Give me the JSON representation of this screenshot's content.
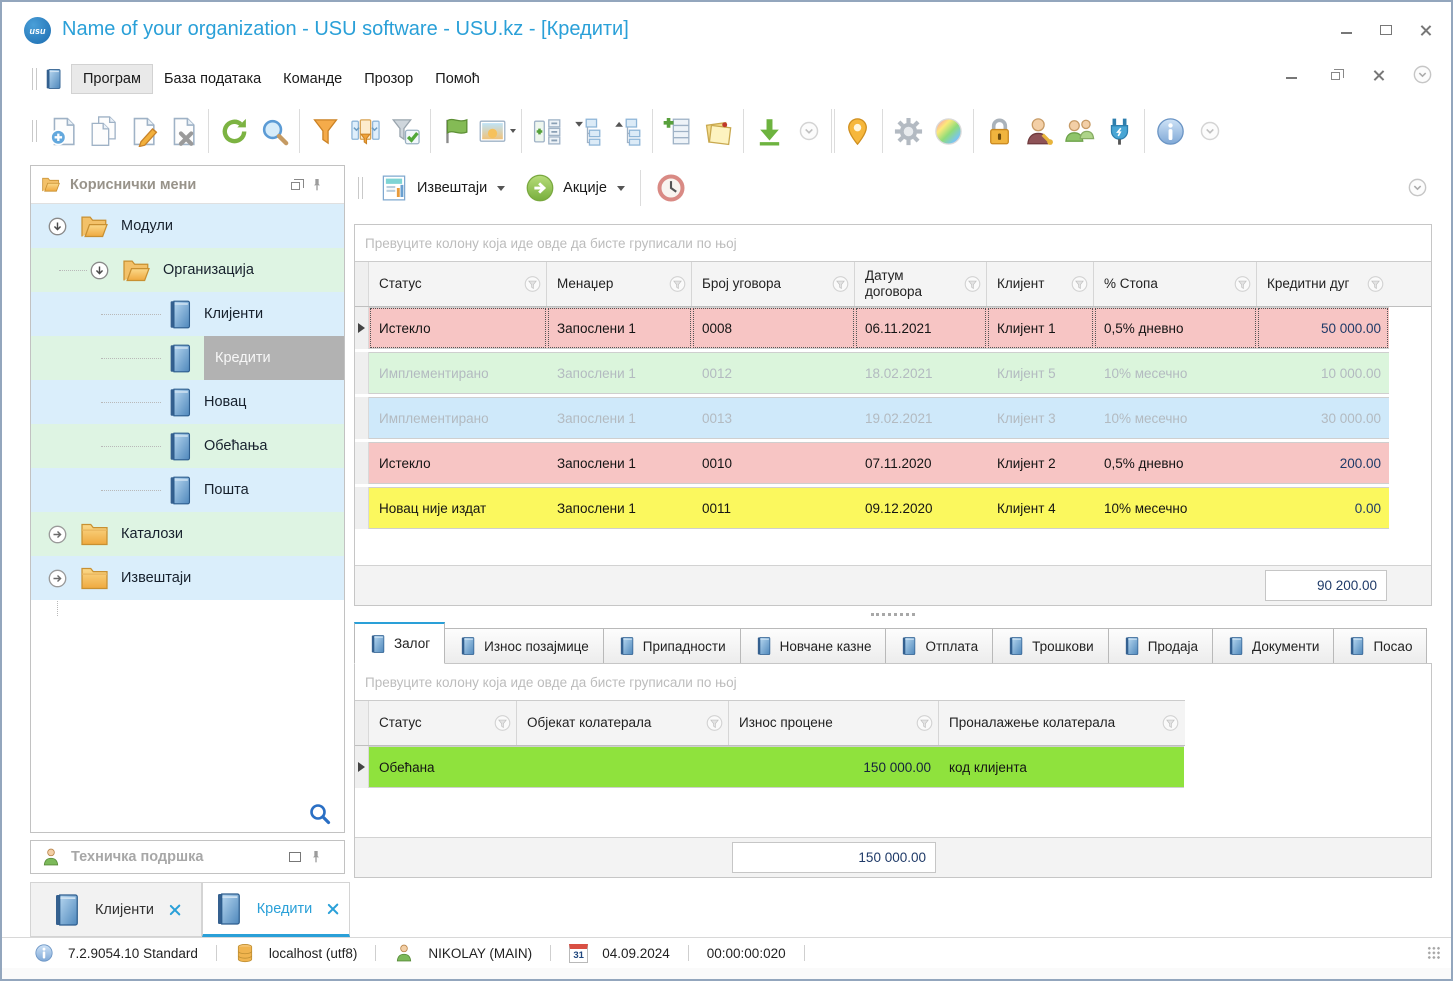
{
  "window": {
    "title": "Name of your organization - USU software - USU.kz - [Кредити]",
    "logo_text": "usu"
  },
  "menu": {
    "items": [
      {
        "label": "Програм"
      },
      {
        "label": "База података"
      },
      {
        "label": "Команде"
      },
      {
        "label": "Прозор"
      },
      {
        "label": "Помоћ"
      }
    ]
  },
  "toolbar": {
    "icons": [
      "new-document",
      "copy-document",
      "edit-document",
      "delete-document",
      "refresh",
      "search",
      "filter",
      "filter-columns",
      "filter-apply",
      "flag",
      "image",
      "tree-list",
      "expand-tree",
      "collapse-tree",
      "add-column",
      "notes",
      "export-download",
      "more-chevron",
      "location-pin",
      "settings-gear",
      "color-palette",
      "lock",
      "user-permissions",
      "user-groups",
      "plugin",
      "info",
      "more-chevron"
    ]
  },
  "sidebar": {
    "title": "Кориснички мени",
    "tree": [
      {
        "label": "Модули"
      },
      {
        "label": "Организација"
      },
      {
        "label": "Клијенти"
      },
      {
        "label": "Кредити"
      },
      {
        "label": "Новац"
      },
      {
        "label": "Обећања"
      },
      {
        "label": "Пошта"
      },
      {
        "label": "Каталози"
      },
      {
        "label": "Извештаји"
      }
    ],
    "support_label": "Техничка подршка"
  },
  "command_bar": {
    "reports": "Извештаји",
    "actions": "Акције"
  },
  "grid": {
    "group_hint": "Превуците колону која иде овде да бисте груписали по њој",
    "columns": [
      "Статус",
      "Менаџер",
      "Број уговора",
      "Датум договора",
      "Клијент",
      "% Стопа",
      "Кредитни дуг"
    ],
    "rows": [
      {
        "status": "Истекло",
        "manager": "Запослени 1",
        "contract": "0008",
        "date": "06.11.2021",
        "client": "Клијент 1",
        "rate": "0,5% дневно",
        "debt": "50 000.00"
      },
      {
        "status": "Имплементирано",
        "manager": "Запослени 1",
        "contract": "0012",
        "date": "18.02.2021",
        "client": "Клијент 5",
        "rate": "10% месечно",
        "debt": "10 000.00"
      },
      {
        "status": "Имплементирано",
        "manager": "Запослени 1",
        "contract": "0013",
        "date": "19.02.2021",
        "client": "Клијент 3",
        "rate": "10% месечно",
        "debt": "30 000.00"
      },
      {
        "status": "Истекло",
        "manager": "Запослени 1",
        "contract": "0010",
        "date": "07.11.2020",
        "client": "Клијент 2",
        "rate": "0,5% дневно",
        "debt": "200.00"
      },
      {
        "status": "Новац није издат",
        "manager": "Запослени 1",
        "contract": "0011",
        "date": "09.12.2020",
        "client": "Клијент 4",
        "rate": "10% месечно",
        "debt": "0.00"
      }
    ],
    "total": "90 200.00",
    "row_colors": {
      "expired": "#f7c5c4",
      "implemented_green": "#dbf5dc",
      "implemented_blue": "#cfe9fa",
      "money_not_issued": "#fbf85e"
    }
  },
  "detail_tabs": [
    {
      "label": "Залог"
    },
    {
      "label": "Износ позајмице"
    },
    {
      "label": "Припадности"
    },
    {
      "label": "Новчане казне"
    },
    {
      "label": "Отплата"
    },
    {
      "label": "Трошкови"
    },
    {
      "label": "Продаја"
    },
    {
      "label": "Документи"
    },
    {
      "label": "Посао"
    }
  ],
  "detail_grid": {
    "group_hint": "Превуците колону која иде овде да бисте груписали по њој",
    "columns": [
      "Статус",
      "Објекат колатерала",
      "Износ процене",
      "Проналажење колатерала"
    ],
    "rows": [
      {
        "status": "Обећана",
        "object": "",
        "amount": "150 000.00",
        "location": "код клијента"
      }
    ],
    "total": "150 000.00",
    "row_color": "#8fe23d"
  },
  "doc_tabs": [
    {
      "label": "Клијенти"
    },
    {
      "label": "Кредити"
    }
  ],
  "statusbar": {
    "version": "7.2.9054.10 Standard",
    "database": "localhost (utf8)",
    "user": "NIKOLAY (MAIN)",
    "calendar_day": "31",
    "date": "04.09.2024",
    "timer": "00:00:00:020"
  },
  "colors": {
    "accent_blue": "#2aa0d8",
    "tree_row_blue": "#daeefb",
    "tree_row_green": "#def4e3",
    "selected_tree_item_bg": "#b2b2b2",
    "number_text": "#1f3a68"
  }
}
